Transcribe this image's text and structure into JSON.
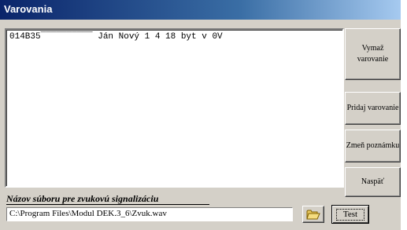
{
  "window": {
    "title": "Varovania"
  },
  "list": {
    "items": [
      "014B35‾‾‾‾‾‾‾‾‾‾ Ján Nový 1 4 18 byt v 0V"
    ]
  },
  "buttons": {
    "delete_warning": "Vymaž varovanie",
    "add_warning": "Pridaj varovanie",
    "change_note": "Zmeň poznámku",
    "back": "Naspäť",
    "test": "Test"
  },
  "sound": {
    "label": "Názov súboru pre zvukovú signalizáciu",
    "file_path": "C:\\Program Files\\Modul DEK.3_6\\Zvuk.wav"
  },
  "icons": {
    "browse": "open-folder-icon"
  },
  "colors": {
    "titlebar_start": "#0a246a",
    "titlebar_end": "#a6caf0",
    "face": "#d4d0c8"
  }
}
